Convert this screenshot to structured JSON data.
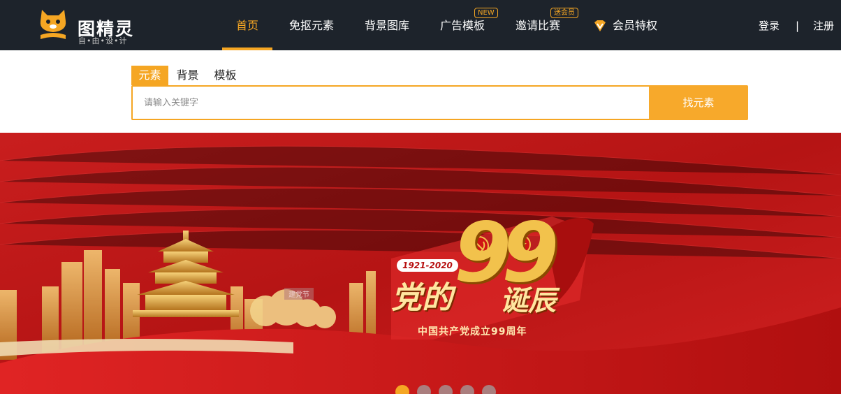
{
  "header": {
    "logo_title": "图精灵",
    "logo_subtitle": "自•由•设•计",
    "nav": [
      {
        "label": "首页",
        "active": true
      },
      {
        "label": "免抠元素"
      },
      {
        "label": "背景图库"
      },
      {
        "label": "广告模板",
        "badge": "NEW"
      },
      {
        "label": "邀请比赛",
        "badge": "送会员"
      },
      {
        "label": "会员特权",
        "icon": "vip-diamond-icon"
      }
    ],
    "login": "登录",
    "separator": "|",
    "register": "注册"
  },
  "search": {
    "tabs": [
      {
        "label": "元素",
        "active": true
      },
      {
        "label": "背景"
      },
      {
        "label": "模板"
      }
    ],
    "placeholder": "请输入关键字",
    "button": "找元素"
  },
  "banner": {
    "years": "1921-2020",
    "number": "99",
    "headline_a": "党的",
    "headline_b": "诞辰",
    "subtitle": "中国共产党成立99周年",
    "label": "建党节",
    "dots": 5,
    "active_dot": 0
  },
  "colors": {
    "accent": "#f5a623",
    "header_bg": "#1d232b",
    "banner_red": "#c51a1a"
  }
}
